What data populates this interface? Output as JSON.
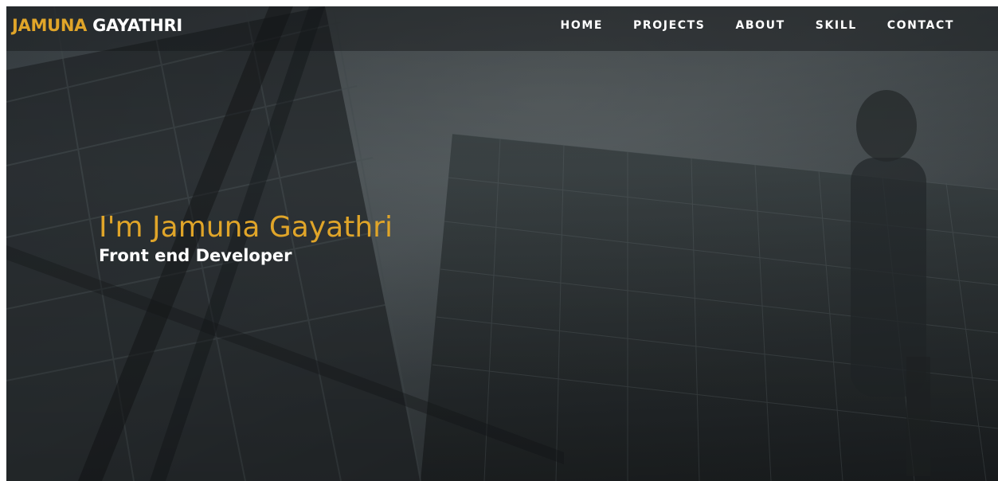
{
  "brand": {
    "first_name": "JAMUNA",
    "last_name": "GAYATHRI"
  },
  "nav": {
    "items": [
      {
        "label": "HOME"
      },
      {
        "label": "PROJECTS"
      },
      {
        "label": "ABOUT"
      },
      {
        "label": "SKILL"
      },
      {
        "label": "CONTACT"
      }
    ]
  },
  "hero": {
    "title": "I'm Jamuna Gayathri",
    "subtitle": "Front end Developer"
  },
  "colors": {
    "accent": "#e0a529",
    "nav_text": "#ffffff",
    "background": "#1c1f21"
  },
  "background_image": "dark-glass-skyscraper-photo"
}
